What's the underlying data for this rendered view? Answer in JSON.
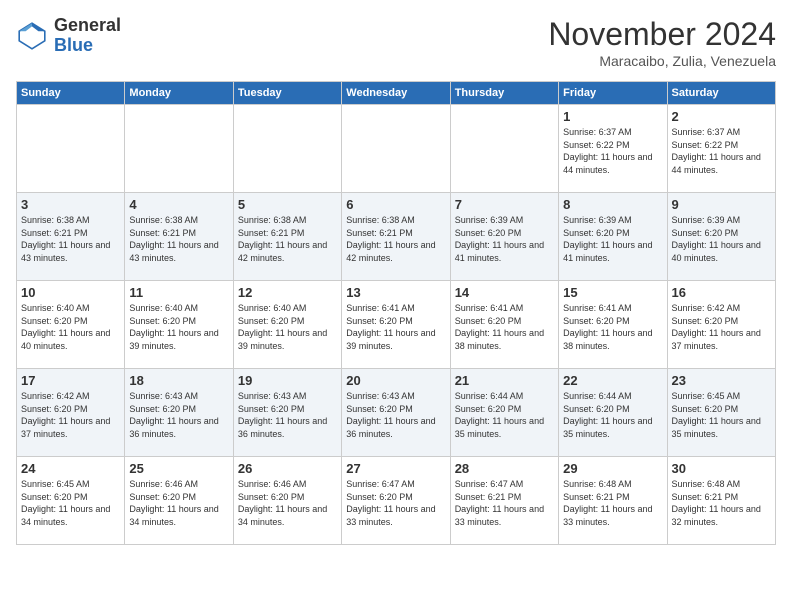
{
  "header": {
    "logo": {
      "general": "General",
      "blue": "Blue"
    },
    "title": "November 2024",
    "location": "Maracaibo, Zulia, Venezuela"
  },
  "calendar": {
    "days_of_week": [
      "Sunday",
      "Monday",
      "Tuesday",
      "Wednesday",
      "Thursday",
      "Friday",
      "Saturday"
    ],
    "weeks": [
      [
        {
          "day": "",
          "info": ""
        },
        {
          "day": "",
          "info": ""
        },
        {
          "day": "",
          "info": ""
        },
        {
          "day": "",
          "info": ""
        },
        {
          "day": "",
          "info": ""
        },
        {
          "day": "1",
          "info": "Sunrise: 6:37 AM\nSunset: 6:22 PM\nDaylight: 11 hours and 44 minutes."
        },
        {
          "day": "2",
          "info": "Sunrise: 6:37 AM\nSunset: 6:22 PM\nDaylight: 11 hours and 44 minutes."
        }
      ],
      [
        {
          "day": "3",
          "info": "Sunrise: 6:38 AM\nSunset: 6:21 PM\nDaylight: 11 hours and 43 minutes."
        },
        {
          "day": "4",
          "info": "Sunrise: 6:38 AM\nSunset: 6:21 PM\nDaylight: 11 hours and 43 minutes."
        },
        {
          "day": "5",
          "info": "Sunrise: 6:38 AM\nSunset: 6:21 PM\nDaylight: 11 hours and 42 minutes."
        },
        {
          "day": "6",
          "info": "Sunrise: 6:38 AM\nSunset: 6:21 PM\nDaylight: 11 hours and 42 minutes."
        },
        {
          "day": "7",
          "info": "Sunrise: 6:39 AM\nSunset: 6:20 PM\nDaylight: 11 hours and 41 minutes."
        },
        {
          "day": "8",
          "info": "Sunrise: 6:39 AM\nSunset: 6:20 PM\nDaylight: 11 hours and 41 minutes."
        },
        {
          "day": "9",
          "info": "Sunrise: 6:39 AM\nSunset: 6:20 PM\nDaylight: 11 hours and 40 minutes."
        }
      ],
      [
        {
          "day": "10",
          "info": "Sunrise: 6:40 AM\nSunset: 6:20 PM\nDaylight: 11 hours and 40 minutes."
        },
        {
          "day": "11",
          "info": "Sunrise: 6:40 AM\nSunset: 6:20 PM\nDaylight: 11 hours and 39 minutes."
        },
        {
          "day": "12",
          "info": "Sunrise: 6:40 AM\nSunset: 6:20 PM\nDaylight: 11 hours and 39 minutes."
        },
        {
          "day": "13",
          "info": "Sunrise: 6:41 AM\nSunset: 6:20 PM\nDaylight: 11 hours and 39 minutes."
        },
        {
          "day": "14",
          "info": "Sunrise: 6:41 AM\nSunset: 6:20 PM\nDaylight: 11 hours and 38 minutes."
        },
        {
          "day": "15",
          "info": "Sunrise: 6:41 AM\nSunset: 6:20 PM\nDaylight: 11 hours and 38 minutes."
        },
        {
          "day": "16",
          "info": "Sunrise: 6:42 AM\nSunset: 6:20 PM\nDaylight: 11 hours and 37 minutes."
        }
      ],
      [
        {
          "day": "17",
          "info": "Sunrise: 6:42 AM\nSunset: 6:20 PM\nDaylight: 11 hours and 37 minutes."
        },
        {
          "day": "18",
          "info": "Sunrise: 6:43 AM\nSunset: 6:20 PM\nDaylight: 11 hours and 36 minutes."
        },
        {
          "day": "19",
          "info": "Sunrise: 6:43 AM\nSunset: 6:20 PM\nDaylight: 11 hours and 36 minutes."
        },
        {
          "day": "20",
          "info": "Sunrise: 6:43 AM\nSunset: 6:20 PM\nDaylight: 11 hours and 36 minutes."
        },
        {
          "day": "21",
          "info": "Sunrise: 6:44 AM\nSunset: 6:20 PM\nDaylight: 11 hours and 35 minutes."
        },
        {
          "day": "22",
          "info": "Sunrise: 6:44 AM\nSunset: 6:20 PM\nDaylight: 11 hours and 35 minutes."
        },
        {
          "day": "23",
          "info": "Sunrise: 6:45 AM\nSunset: 6:20 PM\nDaylight: 11 hours and 35 minutes."
        }
      ],
      [
        {
          "day": "24",
          "info": "Sunrise: 6:45 AM\nSunset: 6:20 PM\nDaylight: 11 hours and 34 minutes."
        },
        {
          "day": "25",
          "info": "Sunrise: 6:46 AM\nSunset: 6:20 PM\nDaylight: 11 hours and 34 minutes."
        },
        {
          "day": "26",
          "info": "Sunrise: 6:46 AM\nSunset: 6:20 PM\nDaylight: 11 hours and 34 minutes."
        },
        {
          "day": "27",
          "info": "Sunrise: 6:47 AM\nSunset: 6:20 PM\nDaylight: 11 hours and 33 minutes."
        },
        {
          "day": "28",
          "info": "Sunrise: 6:47 AM\nSunset: 6:21 PM\nDaylight: 11 hours and 33 minutes."
        },
        {
          "day": "29",
          "info": "Sunrise: 6:48 AM\nSunset: 6:21 PM\nDaylight: 11 hours and 33 minutes."
        },
        {
          "day": "30",
          "info": "Sunrise: 6:48 AM\nSunset: 6:21 PM\nDaylight: 11 hours and 32 minutes."
        }
      ]
    ]
  }
}
